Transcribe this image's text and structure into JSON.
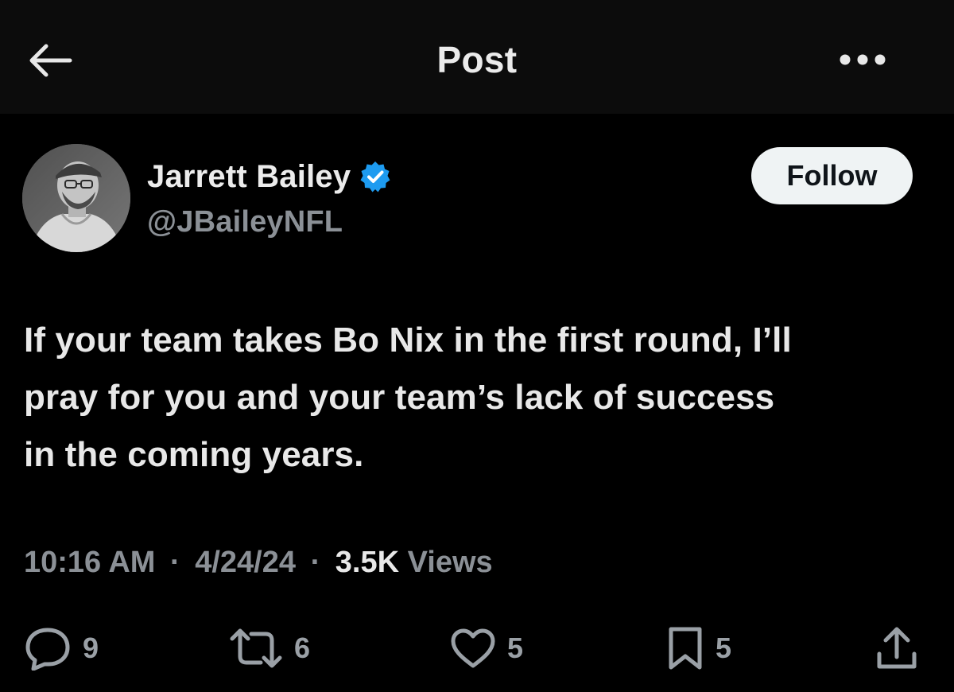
{
  "header": {
    "title": "Post",
    "back_icon": "arrow-left-icon",
    "more_icon": "more-horizontal-icon"
  },
  "author": {
    "name": "Jarrett Bailey",
    "handle": "@JBaileyNFL",
    "verified": true,
    "verified_color": "#1d9bf0",
    "follow_label": "Follow"
  },
  "tweet": {
    "lines": [
      "If your team takes Bo Nix in the first round, I’ll",
      "pray for you and your team’s lack of success",
      "in the coming years."
    ]
  },
  "meta": {
    "time": "10:16 AM",
    "separator": "·",
    "date": "4/24/24",
    "views_count": "3.5K",
    "views_label": "Views"
  },
  "actions": {
    "replies": "9",
    "reposts": "6",
    "likes": "5",
    "bookmarks": "5"
  },
  "colors": {
    "background": "#000000",
    "header_bg": "#0c0c0c",
    "text_primary": "#e8e8e8",
    "text_secondary": "#8b9096",
    "follow_bg": "#eff3f4"
  }
}
